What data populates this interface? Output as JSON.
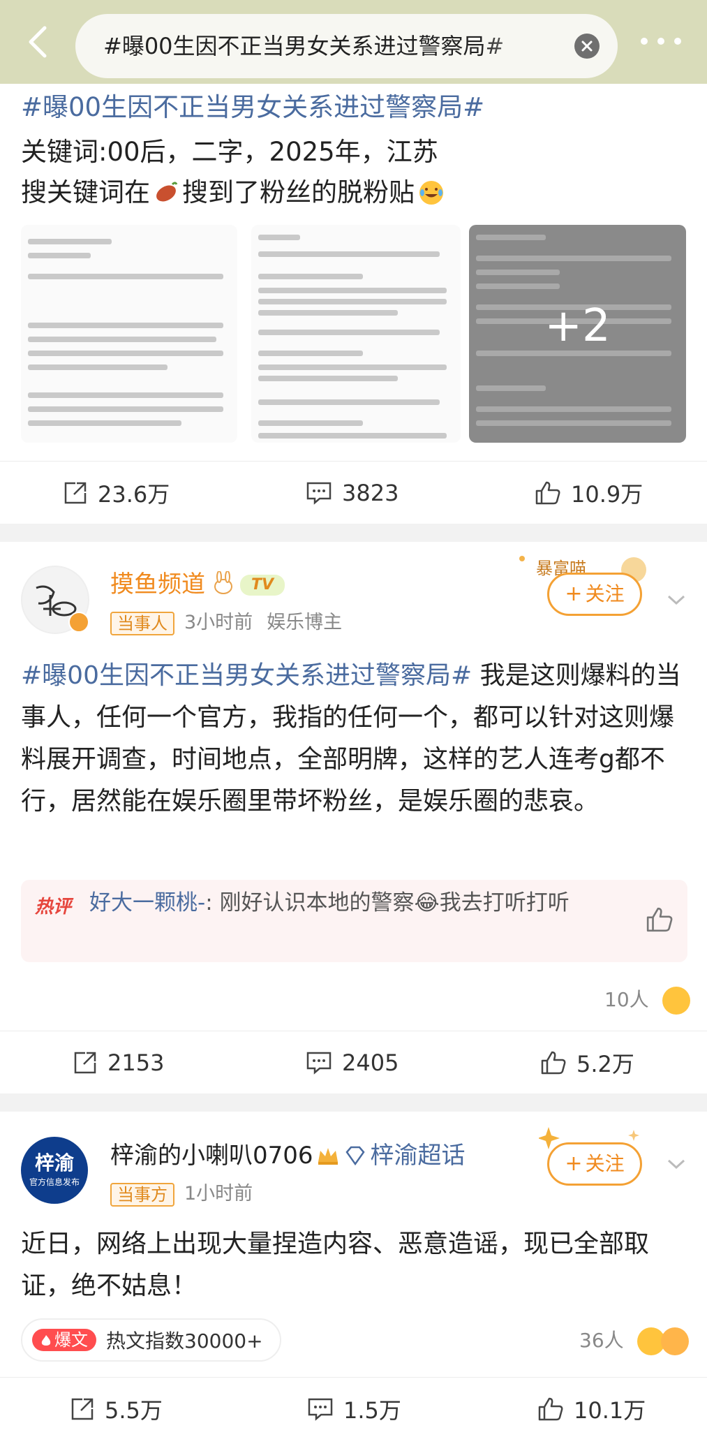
{
  "search": {
    "query": "#曝00生因不正当男女关系进过警察局#"
  },
  "post1": {
    "topic": "#曝00生因不正当男女关系进过警察局#",
    "line1": "关键词:00后，二字，2025年，江苏",
    "line2_a": "搜关键词在",
    "line2_b": "搜到了粉丝的脱粉贴",
    "more_images": "+2",
    "repost": "23.6万",
    "comments": "3823",
    "likes": "10.9万"
  },
  "post2": {
    "author": "摸鱼频道",
    "author_badge": "TV",
    "tag": "当事人",
    "time": "3小时前",
    "role": "娱乐博主",
    "follow": "关注",
    "topic": "#曝00生因不正当男女关系进过警察局#",
    "body": " 我是这则爆料的当事人，任何一个官方，我指的任何一个，都可以针对这则爆料展开调查，时间地点，全部明牌，这样的艺人连考g都不行，居然能在娱乐圈里带坏粉丝，是娱乐圈的悲哀。",
    "hot_label": "热评",
    "hot_user": "好大一颗桃-",
    "hot_text": ": 刚好认识本地的警察😂我去打听打听",
    "reactions": "10人",
    "repost": "2153",
    "comments": "2405",
    "likes": "5.2万"
  },
  "post3": {
    "author": "梓渝的小喇叭0706",
    "super_topic": "梓渝超话",
    "avatar_text_1": "梓渝",
    "avatar_text_2": "官方信息发布",
    "tag": "当事方",
    "time": "1小时前",
    "follow": "关注",
    "body": "近日，网络上出现大量捏造内容、恶意造谣，现已全部取证，绝不姑息！",
    "hot_badge": "爆文",
    "hot_index": "热文指数30000+",
    "reactions": "36人",
    "repost": "5.5万",
    "comments": "1.5万",
    "likes": "10.1万"
  },
  "colors": {
    "topbar": "#d9dcba",
    "topic": "#4a6b9f",
    "follow": "#f08a1e",
    "hot": "#e6453c"
  }
}
